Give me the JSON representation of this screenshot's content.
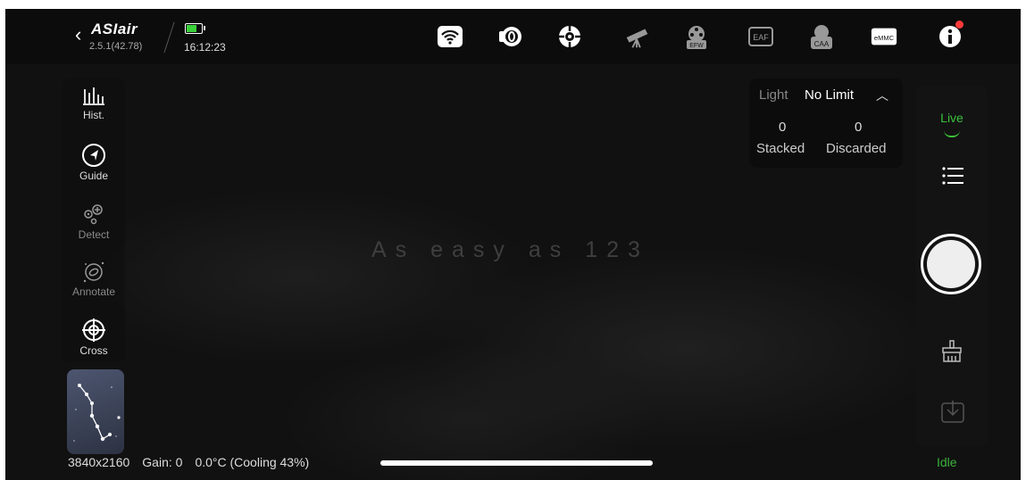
{
  "app": {
    "brand": "ASIair",
    "version": "2.5.1(42.78)",
    "time": "16:12:23",
    "battery_level": 0.75,
    "battery_color": "#3ad13a"
  },
  "top_icons": [
    {
      "name": "wifi-icon"
    },
    {
      "name": "camera-icon"
    },
    {
      "name": "guide-camera-icon"
    },
    {
      "name": "telescope-icon"
    },
    {
      "name": "efw-icon",
      "label": "EFW"
    },
    {
      "name": "eaf-icon",
      "label": "EAF"
    },
    {
      "name": "caa-icon",
      "label": "CAA"
    },
    {
      "name": "emmc-icon",
      "label": "eMMC"
    },
    {
      "name": "info-icon",
      "badge_color": "#ff3a3a"
    }
  ],
  "left_tools": [
    {
      "id": "hist",
      "label": "Hist.",
      "icon": "histogram-icon"
    },
    {
      "id": "guide",
      "label": "Guide",
      "icon": "guide-icon"
    },
    {
      "id": "detect",
      "label": "Detect",
      "icon": "detect-icon"
    },
    {
      "id": "annotate",
      "label": "Annotate",
      "icon": "annotate-icon"
    },
    {
      "id": "cross",
      "label": "Cross",
      "icon": "crosshair-icon"
    }
  ],
  "center": {
    "tagline": "As easy as 123"
  },
  "stack_info": {
    "light_label": "Light",
    "limit_label": "No Limit",
    "stacked_count": "0",
    "stacked_label": "Stacked",
    "discarded_count": "0",
    "discarded_label": "Discarded"
  },
  "right_panel": {
    "live_label": "Live",
    "live_color": "#3cc13c",
    "status": "Idle"
  },
  "status_bar": {
    "resolution": "3840x2160",
    "gain": "Gain: 0",
    "temperature": "0.0°C (Cooling 43%)"
  }
}
